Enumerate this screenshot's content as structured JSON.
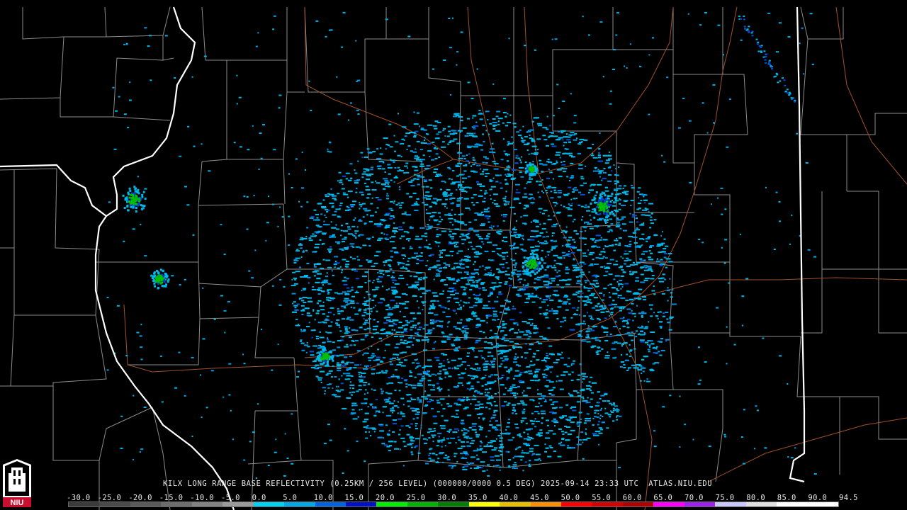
{
  "caption": "KILX LONG RANGE BASE REFLECTIVITY (0.25KM / 256 LEVEL) (000000/0000 0.5 DEG) 2025-09-14 23:33 UTC  ATLAS.NIU.EDU",
  "logo": {
    "text": "NIU",
    "icon": "niu-tower-logo-icon",
    "color": "#c8102e"
  },
  "color_scale": {
    "labels": [
      "-30.0",
      "-25.0",
      "-20.0",
      "-15.0",
      "-10.0",
      "-5.0",
      "0.0",
      "5.0",
      "10.0",
      "15.0",
      "20.0",
      "25.0",
      "30.0",
      "35.0",
      "40.0",
      "45.0",
      "50.0",
      "55.0",
      "60.0",
      "65.0",
      "70.0",
      "75.0",
      "80.0",
      "85.0",
      "90.0",
      "94.5"
    ],
    "colors": [
      "#3a3a3a",
      "#4a4a4a",
      "#5a5a5a",
      "#6e6e6e",
      "#828282",
      "#9a9a9a",
      "#00d2f0",
      "#00a8e8",
      "#0064e0",
      "#0010c8",
      "#00ee00",
      "#00b400",
      "#008000",
      "#ffff00",
      "#e8c000",
      "#ff9000",
      "#ff0000",
      "#d40000",
      "#b00000",
      "#ff00ff",
      "#a020f0",
      "#c8c8ff",
      "#e0e0e0",
      "#ffffff",
      "#ffffff"
    ]
  },
  "map_colors": {
    "state_border": "#ffffff",
    "county_lines": "#8c8c8c",
    "roads": "#a0522d",
    "echo_light": "#00b8e8",
    "echo_dark": "#0050d8",
    "echo_green": "#00c000"
  }
}
